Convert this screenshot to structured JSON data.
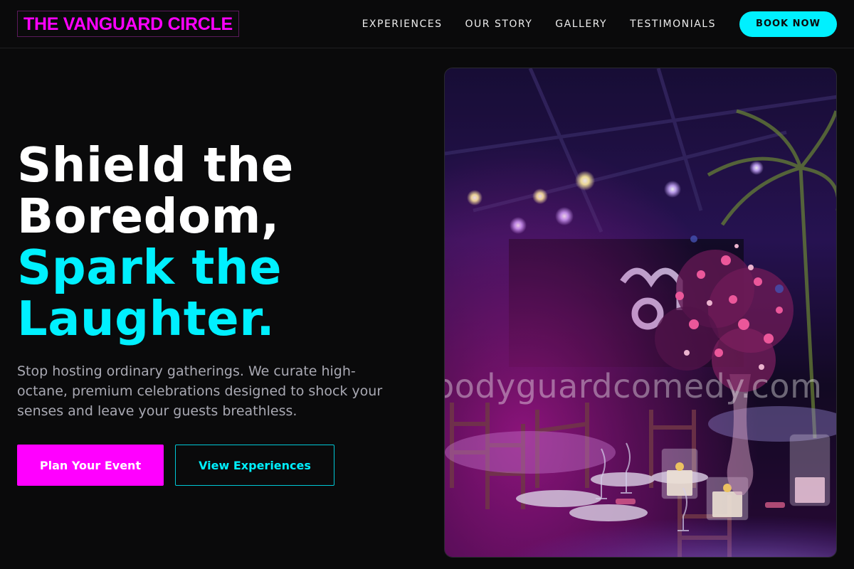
{
  "nav": {
    "logo": "THE VANGUARD CIRCLE",
    "links": [
      "EXPERIENCES",
      "OUR STORY",
      "GALLERY",
      "TESTIMONIALS"
    ],
    "cta": "BOOK NOW"
  },
  "hero": {
    "title_lines": [
      "Shield the",
      "Boredom,"
    ],
    "accent_lines": [
      "Spark the",
      "Laughter."
    ],
    "subtitle": "Stop hosting ordinary gatherings. We curate high-octane, premium celebrations designed to shock your senses and leave your guests breathless.",
    "primary_button": "Plan Your Event",
    "secondary_button": "View Experiences",
    "image_watermark": "bodyguardcomedy.com"
  },
  "colors": {
    "background": "#0a0a0b",
    "brand_magenta": "#ff00ff",
    "accent_cyan": "#00f0ff",
    "subtitle_gray": "#a9a9b3"
  },
  "icons": {
    "image_subject": "event-venue-photo"
  }
}
